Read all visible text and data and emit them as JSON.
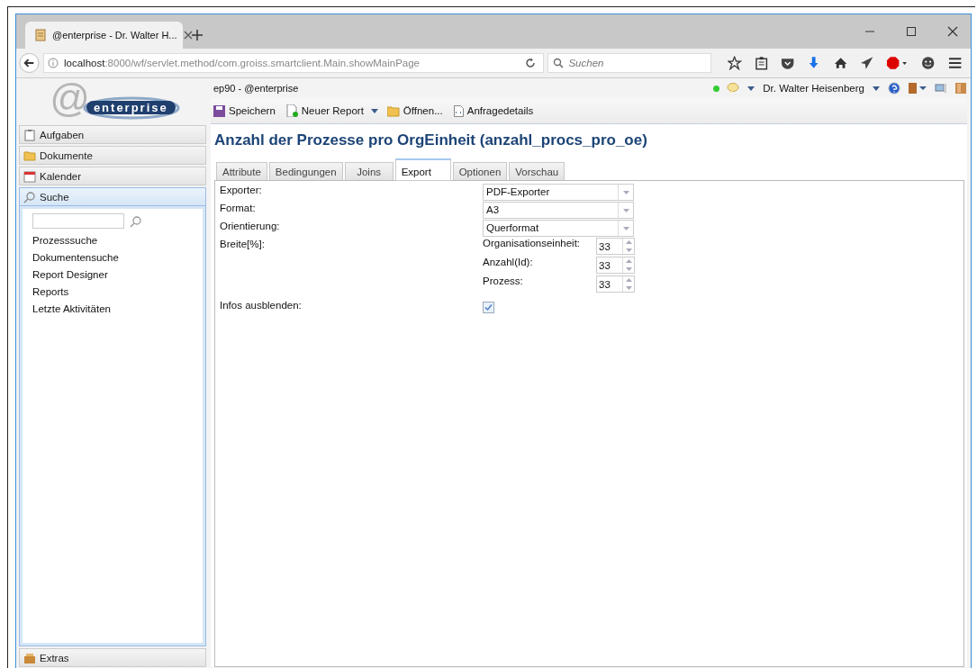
{
  "browser": {
    "tab_title": "@enterprise - Dr. Walter H...",
    "url_host": "localhost",
    "url_path": ":8000/wf/servlet.method/com.groiss.smartclient.Main.showMainPage",
    "search_placeholder": "Suchen"
  },
  "logo": {
    "symbol": "@",
    "text": "enterprise"
  },
  "app": {
    "title": "ep90 - @enterprise",
    "user": "Dr. Walter Heisenberg",
    "online": true
  },
  "toolbar": [
    {
      "label": "Speichern",
      "kind": "save"
    },
    {
      "label": "Neuer Report",
      "kind": "new"
    },
    {
      "label": "Öffnen...",
      "kind": "open"
    },
    {
      "label": "Anfragedetails",
      "kind": "details"
    }
  ],
  "sidebar": {
    "sections": [
      {
        "label": "Aufgaben",
        "kind": "tasks",
        "expanded": false
      },
      {
        "label": "Dokumente",
        "kind": "documents",
        "expanded": false
      },
      {
        "label": "Kalender",
        "kind": "calendar",
        "expanded": false
      },
      {
        "label": "Suche",
        "kind": "search",
        "expanded": true
      }
    ],
    "search_links": [
      "Prozesssuche",
      "Dokumentensuche",
      "Report Designer",
      "Reports",
      "Letzte Aktivitäten"
    ],
    "footer_section": {
      "label": "Extras"
    }
  },
  "report": {
    "title": "Anzahl der Prozesse pro OrgEinheit (anzahl_procs_pro_oe)",
    "tabs": [
      {
        "label": "Attribute",
        "selected": false
      },
      {
        "label": "Bedingungen",
        "selected": false
      },
      {
        "label": "Joins",
        "selected": false
      },
      {
        "label": "Export",
        "selected": true
      },
      {
        "label": "Optionen",
        "selected": false
      },
      {
        "label": "Vorschau",
        "selected": false
      }
    ],
    "fields": [
      {
        "kind": "select",
        "label": "Exporter:",
        "value": "PDF-Exporter"
      },
      {
        "kind": "select",
        "label": "Format:",
        "value": "A3"
      },
      {
        "kind": "select",
        "label": "Orientierung:",
        "value": "Querformat"
      },
      {
        "kind": "widths",
        "label": "Breite[%]:",
        "columns": [
          {
            "label": "Organisationseinheit:",
            "value": "33"
          },
          {
            "label": "Anzahl(Id):",
            "value": "33"
          },
          {
            "label": "Prozess:",
            "value": "33"
          }
        ]
      },
      {
        "kind": "checkbox",
        "label": "Infos ausblenden:",
        "checked": true
      }
    ]
  }
}
